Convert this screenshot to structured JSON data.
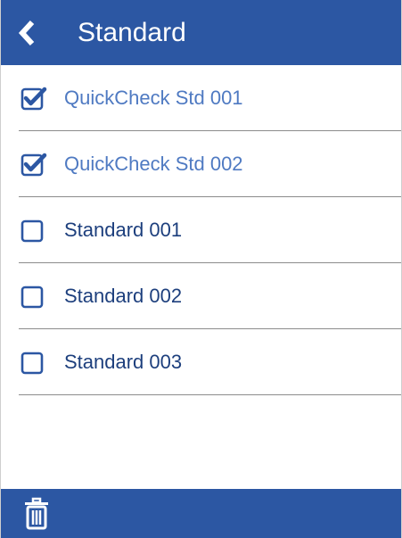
{
  "header": {
    "title": "Standard",
    "back_icon": "chevron-left-icon"
  },
  "standards": [
    {
      "label": "QuickCheck Std 001",
      "checked": true
    },
    {
      "label": "QuickCheck Std 002",
      "checked": true
    },
    {
      "label": "Standard 001",
      "checked": false
    },
    {
      "label": "Standard 002",
      "checked": false
    },
    {
      "label": "Standard 003",
      "checked": false
    }
  ],
  "footer": {
    "delete_icon": "trash-icon"
  },
  "colors": {
    "header_bg": "#2c57a3",
    "checked_text": "#4f7ac2",
    "unchecked_text": "#1d3f7d",
    "checkbox_border": "#2c57a3",
    "divider": "#8c8c8c"
  }
}
